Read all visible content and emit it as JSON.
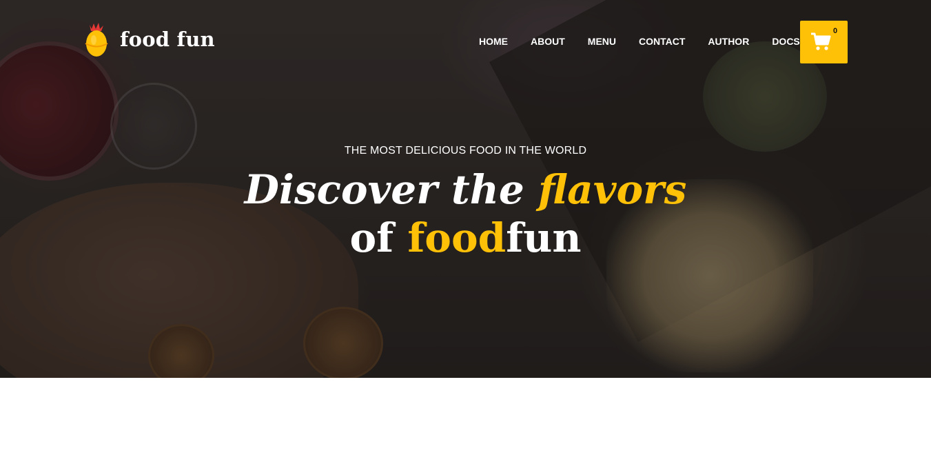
{
  "brand": {
    "name": "food fun",
    "logo_icon": "egg-chick-icon"
  },
  "nav": {
    "items": [
      {
        "label": "HOME"
      },
      {
        "label": "ABOUT"
      },
      {
        "label": "MENU"
      },
      {
        "label": "CONTACT"
      },
      {
        "label": "AUTHOR"
      },
      {
        "label": "DOCS"
      }
    ]
  },
  "cart": {
    "icon": "shopping-cart-icon",
    "count": "0"
  },
  "hero": {
    "tagline": "THE MOST DELICIOUS FOOD IN THE WORLD",
    "headline_line1_part1": "Discover the ",
    "headline_line1_accent": "flavors",
    "headline_line2_part1": "of ",
    "headline_line2_accent": "food",
    "headline_line2_part2": "fun"
  },
  "colors": {
    "accent": "#ffc107",
    "text_light": "#ffffff",
    "overlay": "#141210"
  }
}
